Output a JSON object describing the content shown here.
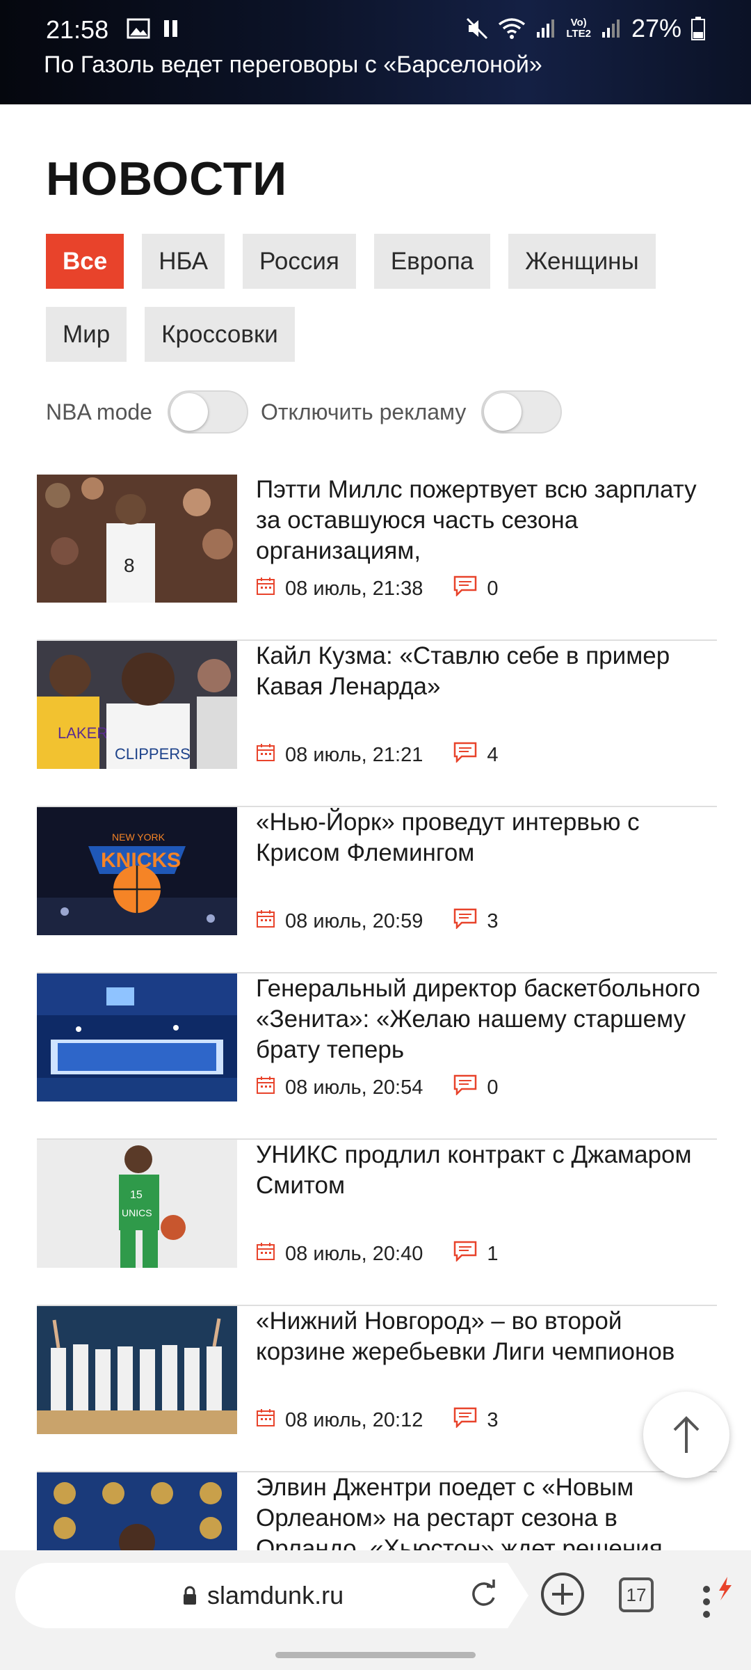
{
  "status_bar": {
    "time": "21:58",
    "battery": "27%",
    "network": "Vo) LTE2"
  },
  "banner": {
    "title": "По Газоль ведет переговоры с «Барселоной»"
  },
  "page": {
    "title": "НОВОСТИ"
  },
  "filters": [
    "Все",
    "НБА",
    "Россия",
    "Европа",
    "Женщины",
    "Мир",
    "Кроссовки"
  ],
  "toggles": {
    "nba_mode": "NBA mode",
    "disable_ads": "Отключить рекламу"
  },
  "news": [
    {
      "title": "Пэтти Миллс пожертвует всю зарплату за оставшуюся часть сезона организациям,",
      "date": "08 июль, 21:38",
      "comments": "0"
    },
    {
      "title": "Кайл Кузма: «Ставлю себе в пример Кавая Ленарда»",
      "date": "08 июль, 21:21",
      "comments": "4"
    },
    {
      "title": "«Нью-Йорк» проведут интервью с Крисом Флемингом",
      "date": "08 июль, 20:59",
      "comments": "3"
    },
    {
      "title": "Генеральный директор баскетбольного «Зенита»: «Желаю нашему старшему брату теперь",
      "date": "08 июль, 20:54",
      "comments": "0"
    },
    {
      "title": "УНИКС продлил контракт с Джамаром Смитом",
      "date": "08 июль, 20:40",
      "comments": "1"
    },
    {
      "title": "«Нижний Новгород» – во второй корзине жеребьевки Лиги чемпионов",
      "date": "08 июль, 20:12",
      "comments": "3"
    },
    {
      "title": "Элвин Джентри поедет с «Новым Орлеаном» на рестарт сезона в Орландо, «Хьюстон» ждет решения",
      "date": "",
      "comments": ""
    }
  ],
  "browser": {
    "url": "slamdunk.ru",
    "tab_count": "17"
  },
  "colors": {
    "accent": "#e8432b",
    "chip_bg": "#e8e8e8"
  }
}
